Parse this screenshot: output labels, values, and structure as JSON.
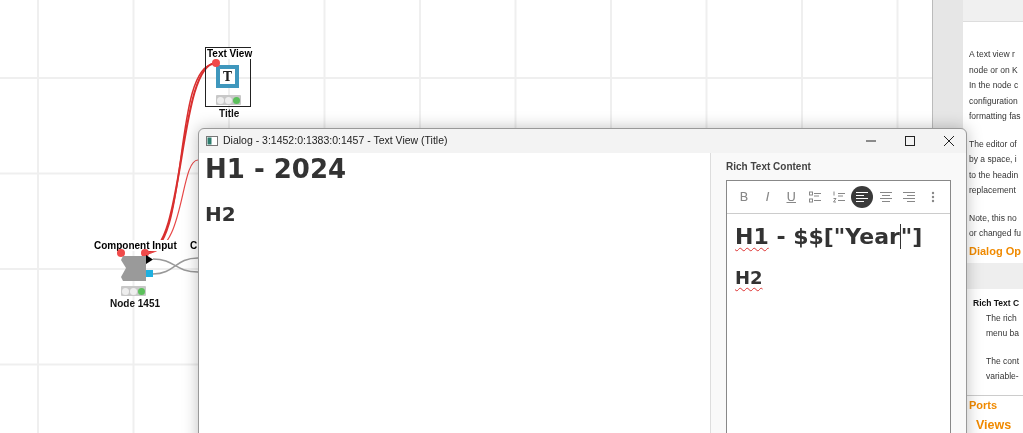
{
  "canvas": {
    "nodes": [
      {
        "kind": "view",
        "label": "Text View",
        "icon_glyph": "T",
        "name": "Title",
        "executed": true,
        "selected": true
      },
      {
        "kind": "component_input",
        "label": "Component Input",
        "name": "Node 1451",
        "executed": true
      },
      {
        "kind": "partial",
        "label": "C"
      }
    ]
  },
  "dialog": {
    "title": "Dialog - 3:1452:0:1383:0:1457 - Text View (Title)",
    "preview": [
      {
        "kind": "h1",
        "text": "H1 - 2024"
      },
      {
        "kind": "h2",
        "text": "H2"
      }
    ],
    "editor_label": "Rich Text Content",
    "toolbar": [
      {
        "kind": "bold",
        "label": "B",
        "selected": false
      },
      {
        "kind": "italic",
        "label": "I",
        "selected": false
      },
      {
        "kind": "underline",
        "label": "U",
        "selected": false
      },
      {
        "kind": "bullet_list",
        "selected": false
      },
      {
        "kind": "ordered_list",
        "selected": false
      },
      {
        "kind": "align_left",
        "selected": true
      },
      {
        "kind": "align_center",
        "selected": false
      },
      {
        "kind": "align_right",
        "selected": false
      },
      {
        "kind": "more",
        "selected": false
      }
    ],
    "content": [
      {
        "kind": "h1",
        "parts": [
          {
            "text": "H1",
            "misspelled": true
          },
          {
            "text": " - $$[\"Year",
            "misspelled": false
          },
          {
            "text": "\"]",
            "misspelled": false,
            "caret_before": true
          }
        ]
      },
      {
        "kind": "h2",
        "parts": [
          {
            "text": "H2",
            "misspelled": true
          }
        ]
      }
    ]
  },
  "description": {
    "lines": [
      {
        "kind": "text",
        "text": "A text view r"
      },
      {
        "kind": "text",
        "text": "node or on K"
      },
      {
        "kind": "text",
        "text": "In the node c"
      },
      {
        "kind": "text",
        "text": "configuration"
      },
      {
        "kind": "text",
        "text": "formatting fas"
      },
      {
        "kind": "gap"
      },
      {
        "kind": "text",
        "text": "The editor of"
      },
      {
        "kind": "text",
        "text": "by a space, i"
      },
      {
        "kind": "text",
        "text": "to the headin"
      },
      {
        "kind": "text",
        "text": "replacement"
      },
      {
        "kind": "gap"
      },
      {
        "kind": "text",
        "text": "Note, this no"
      },
      {
        "kind": "text",
        "text": "or changed fu"
      },
      {
        "kind": "heading",
        "text": "Dialog Op"
      },
      {
        "kind": "band"
      },
      {
        "kind": "option",
        "text": "Rich Text C"
      },
      {
        "kind": "indented",
        "text": "The rich"
      },
      {
        "kind": "indented",
        "text": "menu ba"
      },
      {
        "kind": "gap"
      },
      {
        "kind": "indented",
        "text": "The cont"
      },
      {
        "kind": "indented",
        "text": "variable-"
      },
      {
        "kind": "rule"
      },
      {
        "kind": "heading",
        "text": "Ports"
      },
      {
        "kind": "subheading",
        "text": "Views"
      }
    ]
  }
}
